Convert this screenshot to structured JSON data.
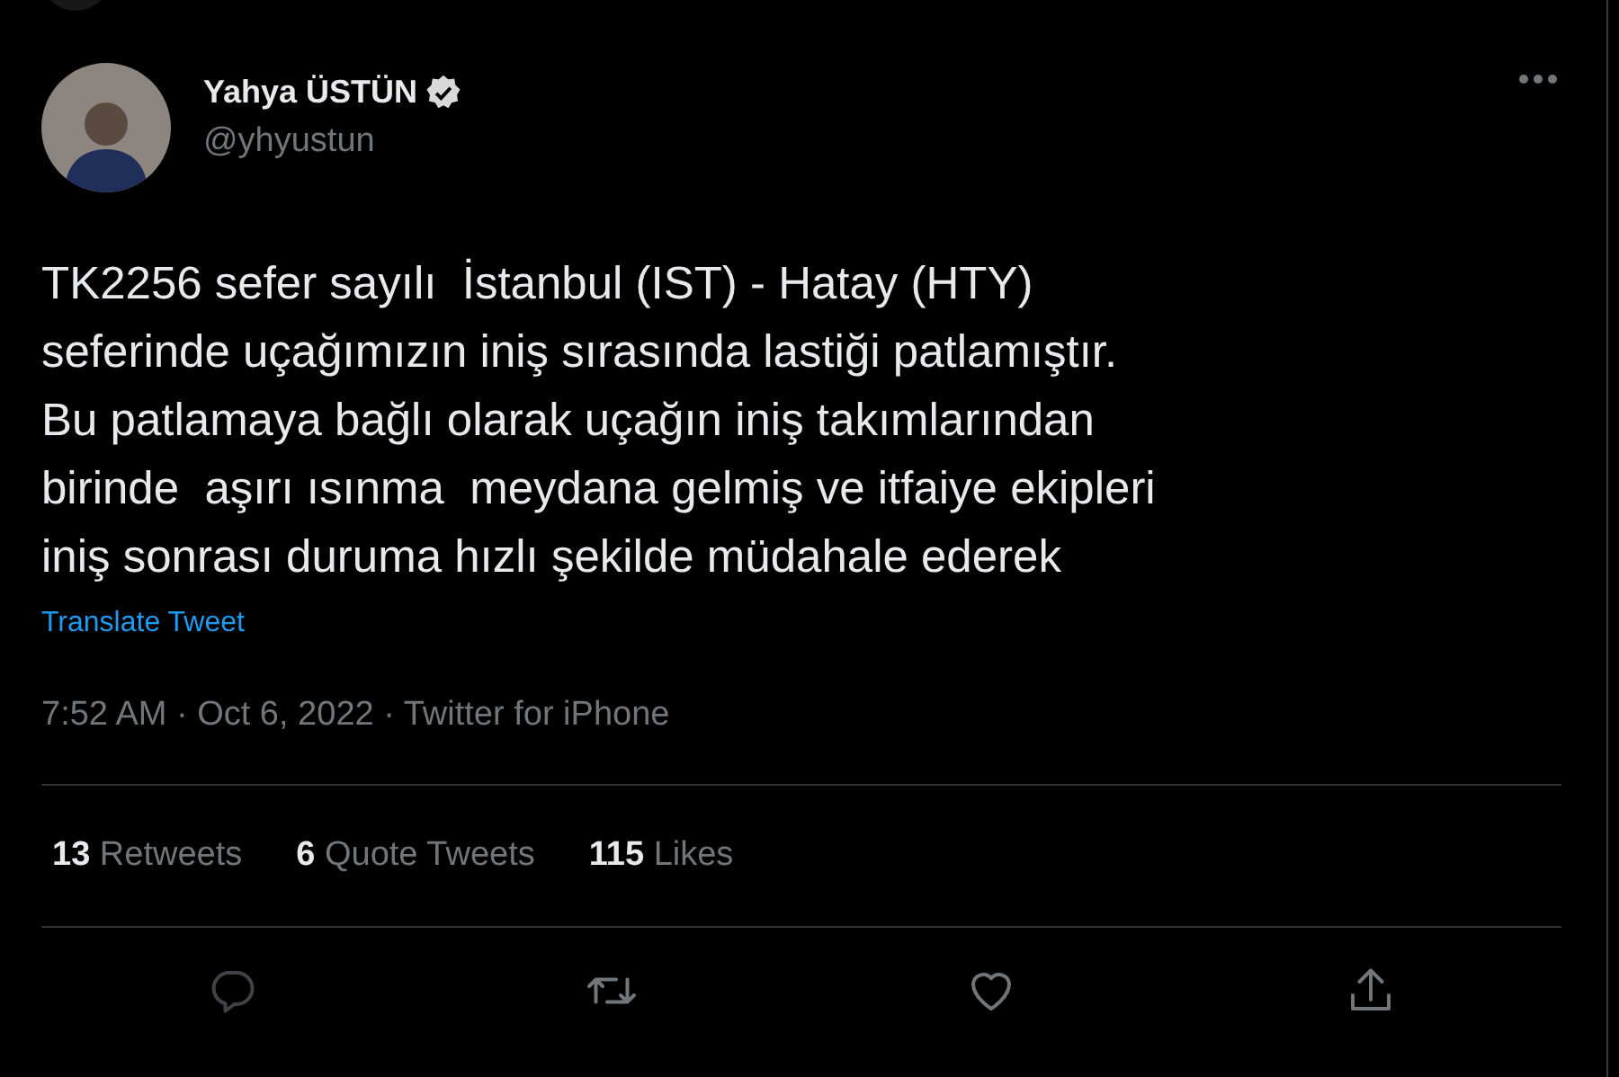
{
  "author": {
    "name": "Yahya ÜSTÜN",
    "verified": true,
    "handle": "@yhyustun"
  },
  "tweet": {
    "lines": [
      "TK2256 sefer sayılı  İstanbul (IST) - Hatay (HTY)",
      "seferinde uçağımızın iniş sırasında lastiği patlamıştır.",
      "Bu patlamaya bağlı olarak uçağın iniş takımlarından",
      "birinde  aşırı ısınma  meydana gelmiş ve itfaiye ekipleri",
      "iniş sonrası duruma hızlı şekilde müdahale ederek"
    ],
    "translate": "Translate Tweet",
    "timestamp": "7:52 AM · Oct 6, 2022 · Twitter for iPhone"
  },
  "stats": [
    {
      "count": "13",
      "label": "Retweets"
    },
    {
      "count": "6",
      "label": "Quote Tweets"
    },
    {
      "count": "115",
      "label": "Likes"
    }
  ],
  "actions": [
    {
      "kind": "reply"
    },
    {
      "kind": "retweet"
    },
    {
      "kind": "like"
    },
    {
      "kind": "share"
    }
  ]
}
